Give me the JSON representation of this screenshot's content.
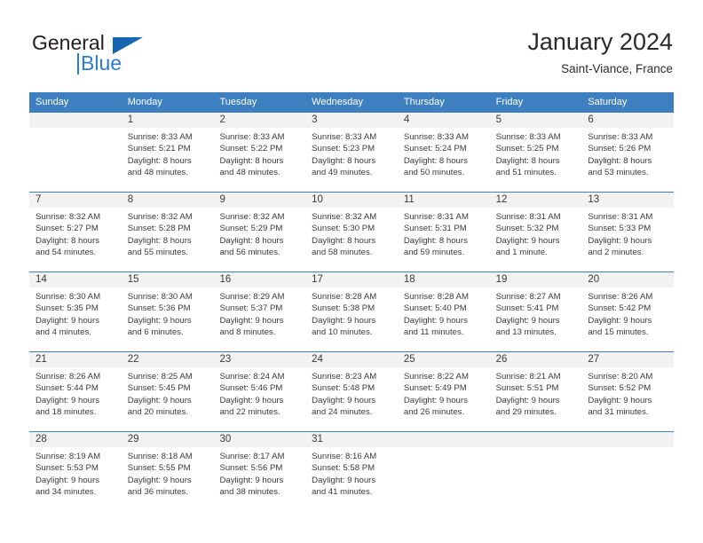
{
  "brand": {
    "word_one": "General",
    "word_two": "Blue",
    "triangle_color": "#1565b0",
    "blue_color": "#2b7cd3"
  },
  "header": {
    "title": "January 2024",
    "subtitle": "Saint-Viance, France"
  },
  "theme": {
    "header_blue": "#3d7fbf",
    "day_band_gray": "#f2f2f2"
  },
  "calendar": {
    "weekdays": [
      "Sunday",
      "Monday",
      "Tuesday",
      "Wednesday",
      "Thursday",
      "Friday",
      "Saturday"
    ],
    "weeks": [
      [
        {
          "day": "",
          "info": ""
        },
        {
          "day": "1",
          "info": "Sunrise: 8:33 AM\nSunset: 5:21 PM\nDaylight: 8 hours\nand 48 minutes."
        },
        {
          "day": "2",
          "info": "Sunrise: 8:33 AM\nSunset: 5:22 PM\nDaylight: 8 hours\nand 48 minutes."
        },
        {
          "day": "3",
          "info": "Sunrise: 8:33 AM\nSunset: 5:23 PM\nDaylight: 8 hours\nand 49 minutes."
        },
        {
          "day": "4",
          "info": "Sunrise: 8:33 AM\nSunset: 5:24 PM\nDaylight: 8 hours\nand 50 minutes."
        },
        {
          "day": "5",
          "info": "Sunrise: 8:33 AM\nSunset: 5:25 PM\nDaylight: 8 hours\nand 51 minutes."
        },
        {
          "day": "6",
          "info": "Sunrise: 8:33 AM\nSunset: 5:26 PM\nDaylight: 8 hours\nand 53 minutes."
        }
      ],
      [
        {
          "day": "7",
          "info": "Sunrise: 8:32 AM\nSunset: 5:27 PM\nDaylight: 8 hours\nand 54 minutes."
        },
        {
          "day": "8",
          "info": "Sunrise: 8:32 AM\nSunset: 5:28 PM\nDaylight: 8 hours\nand 55 minutes."
        },
        {
          "day": "9",
          "info": "Sunrise: 8:32 AM\nSunset: 5:29 PM\nDaylight: 8 hours\nand 56 minutes."
        },
        {
          "day": "10",
          "info": "Sunrise: 8:32 AM\nSunset: 5:30 PM\nDaylight: 8 hours\nand 58 minutes."
        },
        {
          "day": "11",
          "info": "Sunrise: 8:31 AM\nSunset: 5:31 PM\nDaylight: 8 hours\nand 59 minutes."
        },
        {
          "day": "12",
          "info": "Sunrise: 8:31 AM\nSunset: 5:32 PM\nDaylight: 9 hours\nand 1 minute."
        },
        {
          "day": "13",
          "info": "Sunrise: 8:31 AM\nSunset: 5:33 PM\nDaylight: 9 hours\nand 2 minutes."
        }
      ],
      [
        {
          "day": "14",
          "info": "Sunrise: 8:30 AM\nSunset: 5:35 PM\nDaylight: 9 hours\nand 4 minutes."
        },
        {
          "day": "15",
          "info": "Sunrise: 8:30 AM\nSunset: 5:36 PM\nDaylight: 9 hours\nand 6 minutes."
        },
        {
          "day": "16",
          "info": "Sunrise: 8:29 AM\nSunset: 5:37 PM\nDaylight: 9 hours\nand 8 minutes."
        },
        {
          "day": "17",
          "info": "Sunrise: 8:28 AM\nSunset: 5:38 PM\nDaylight: 9 hours\nand 10 minutes."
        },
        {
          "day": "18",
          "info": "Sunrise: 8:28 AM\nSunset: 5:40 PM\nDaylight: 9 hours\nand 11 minutes."
        },
        {
          "day": "19",
          "info": "Sunrise: 8:27 AM\nSunset: 5:41 PM\nDaylight: 9 hours\nand 13 minutes."
        },
        {
          "day": "20",
          "info": "Sunrise: 8:26 AM\nSunset: 5:42 PM\nDaylight: 9 hours\nand 15 minutes."
        }
      ],
      [
        {
          "day": "21",
          "info": "Sunrise: 8:26 AM\nSunset: 5:44 PM\nDaylight: 9 hours\nand 18 minutes."
        },
        {
          "day": "22",
          "info": "Sunrise: 8:25 AM\nSunset: 5:45 PM\nDaylight: 9 hours\nand 20 minutes."
        },
        {
          "day": "23",
          "info": "Sunrise: 8:24 AM\nSunset: 5:46 PM\nDaylight: 9 hours\nand 22 minutes."
        },
        {
          "day": "24",
          "info": "Sunrise: 8:23 AM\nSunset: 5:48 PM\nDaylight: 9 hours\nand 24 minutes."
        },
        {
          "day": "25",
          "info": "Sunrise: 8:22 AM\nSunset: 5:49 PM\nDaylight: 9 hours\nand 26 minutes."
        },
        {
          "day": "26",
          "info": "Sunrise: 8:21 AM\nSunset: 5:51 PM\nDaylight: 9 hours\nand 29 minutes."
        },
        {
          "day": "27",
          "info": "Sunrise: 8:20 AM\nSunset: 5:52 PM\nDaylight: 9 hours\nand 31 minutes."
        }
      ],
      [
        {
          "day": "28",
          "info": "Sunrise: 8:19 AM\nSunset: 5:53 PM\nDaylight: 9 hours\nand 34 minutes."
        },
        {
          "day": "29",
          "info": "Sunrise: 8:18 AM\nSunset: 5:55 PM\nDaylight: 9 hours\nand 36 minutes."
        },
        {
          "day": "30",
          "info": "Sunrise: 8:17 AM\nSunset: 5:56 PM\nDaylight: 9 hours\nand 38 minutes."
        },
        {
          "day": "31",
          "info": "Sunrise: 8:16 AM\nSunset: 5:58 PM\nDaylight: 9 hours\nand 41 minutes."
        },
        {
          "day": "",
          "info": ""
        },
        {
          "day": "",
          "info": ""
        },
        {
          "day": "",
          "info": ""
        }
      ]
    ]
  }
}
